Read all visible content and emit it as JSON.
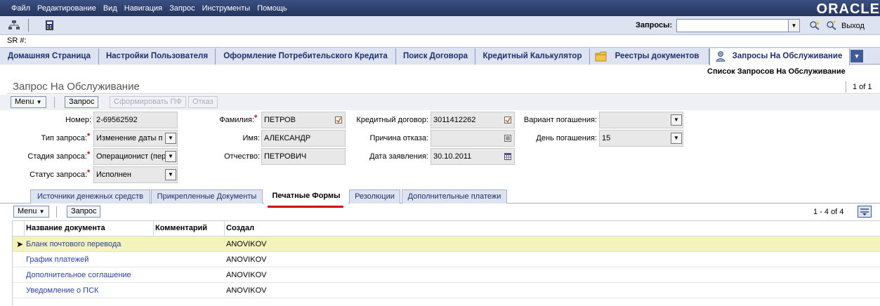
{
  "menu": {
    "items": [
      "Файл",
      "Редактирование",
      "Вид",
      "Навигация",
      "Запрос",
      "Инструменты",
      "Помощь"
    ],
    "brand": "ORACLE"
  },
  "toolbar": {
    "requests_label": "Запросы:",
    "requests_value": "",
    "exit_label": "Выход"
  },
  "sr_label": "SR #:",
  "tabs": [
    "Домашняя Страница",
    "Настройки Пользователя",
    "Оформление Потребительского Кредита",
    "Поиск Договора",
    "Кредитный Калькулятор",
    "Реестры документов",
    "Запросы На Обслуживание"
  ],
  "sub_link": "Список Запросов На Обслуживание",
  "applet": {
    "title": "Запрос На Обслуживание",
    "count": "1 of 1",
    "menu_btn": "Menu",
    "query_btn": "Запрос",
    "gen_btn": "Сформировать ПФ",
    "reject_btn": "Отказ"
  },
  "form": {
    "number_label": "Номер:",
    "number": "2-69562592",
    "type_label": "Тип запроса:",
    "type": "Изменение даты п",
    "stage_label": "Стадия запроса:",
    "stage": "Операционист (пер",
    "status_label": "Статус запроса:",
    "status": "Исполнен",
    "lastname_label": "Фамилия:",
    "lastname": "ПЕТРОВ",
    "firstname_label": "Имя:",
    "firstname": "АЛЕКСАНДР",
    "middlename_label": "Отчество:",
    "middlename": "ПЕТРОВИЧ",
    "contract_label": "Кредитный договор:",
    "contract": "3011412262",
    "reject_reason_label": "Причина отказа:",
    "reject_reason": "",
    "app_date_label": "Дата заявления:",
    "app_date": "30.10.2011",
    "repay_variant_label": "Вариант погашения:",
    "repay_variant": "",
    "repay_day_label": "День погашения:",
    "repay_day": "15"
  },
  "subtabs": [
    "Источники денежных средств",
    "Прикрепленные Документы",
    "Печатные Формы",
    "Резолюции",
    "Дополнительные платежи"
  ],
  "list": {
    "menu_btn": "Menu",
    "query_btn": "Запрос",
    "count": "1 - 4 of 4",
    "columns": [
      "Название документа",
      "Комментарий",
      "Создал"
    ],
    "rows": [
      {
        "name": "Бланк почтового перевода",
        "comment": "",
        "author": "ANOVIKOV"
      },
      {
        "name": "График платежей",
        "comment": "",
        "author": "ANOVIKOV"
      },
      {
        "name": "Дополнительное соглашение",
        "comment": "",
        "author": "ANOVIKOV"
      },
      {
        "name": "Уведомление о ПСК",
        "comment": "",
        "author": "ANOVIKOV"
      }
    ]
  },
  "colors": {
    "menubar": "#2c3e6e",
    "tab_text": "#1e2f6b",
    "link": "#2a3fa0",
    "selected_row": "#f4f3ba",
    "active_underline": "#d40000"
  }
}
